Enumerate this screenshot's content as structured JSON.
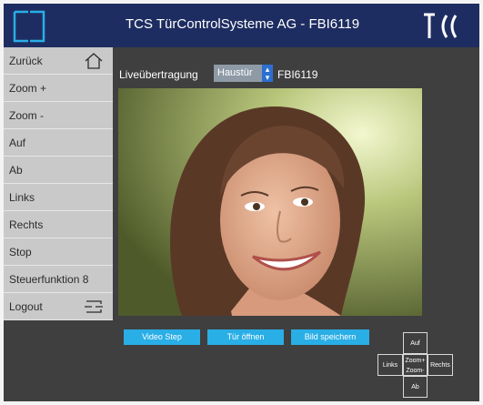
{
  "header": {
    "title": "TCS TürControlSysteme AG - FBI6119",
    "brand_logo": "TCS",
    "colors": {
      "header_bg": "#1e2d61",
      "logo_accent": "#29aee6"
    }
  },
  "sidebar": {
    "items": [
      {
        "label": "Zurück",
        "icon": "home-icon"
      },
      {
        "label": "Zoom +"
      },
      {
        "label": "Zoom -"
      },
      {
        "label": "Auf"
      },
      {
        "label": "Ab"
      },
      {
        "label": "Links"
      },
      {
        "label": "Rechts"
      },
      {
        "label": "Stop"
      },
      {
        "label": "Steuerfunktion 8"
      },
      {
        "label": "Logout",
        "icon": "logout-icon"
      }
    ]
  },
  "main": {
    "live_label": "Liveübertragung",
    "door_select": {
      "selected": "Haustür"
    },
    "device_label": "FBI6119",
    "video": {
      "content": "camera-feed"
    }
  },
  "actions": {
    "video_step": "Video Step",
    "open_door": "Tür öffnen",
    "save_image": "Bild speichern",
    "color": "#29aee6"
  },
  "dpad": {
    "up": "Auf",
    "left": "Links",
    "zoom_plus": "Zoom+",
    "zoom_minus": "Zoom-",
    "right": "Rechts",
    "down": "Ab"
  }
}
